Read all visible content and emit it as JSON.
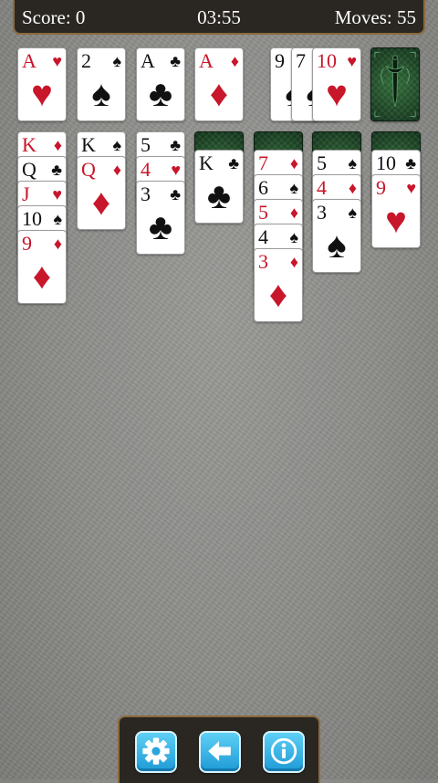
{
  "status_bar": {
    "score": "Score: 0",
    "timer": "03:55",
    "moves": "Moves: 55"
  },
  "colors": {
    "red_suit": "#c8162a",
    "black_suit": "#111111",
    "card_back": "#1f4a26",
    "button": "#1e9ad6",
    "bar_border": "#8a6a3c"
  },
  "foundations": [
    {
      "rank": "A",
      "suit": "♥",
      "color": "red"
    },
    {
      "rank": "2",
      "suit": "♠",
      "color": "black"
    },
    {
      "rank": "A",
      "suit": "♣",
      "color": "black"
    },
    {
      "rank": "A",
      "suit": "♦",
      "color": "red"
    }
  ],
  "waste": [
    {
      "rank": "9",
      "suit": "♠",
      "color": "black"
    },
    {
      "rank": "7",
      "suit": "♠",
      "color": "black"
    },
    {
      "rank": "10",
      "suit": "♥",
      "color": "red"
    }
  ],
  "stock": {
    "icon": "dagger-emblem-icon",
    "face_down": true
  },
  "tableau": [
    {
      "face_down": 0,
      "cards": [
        {
          "rank": "K",
          "suit": "♦",
          "color": "red"
        },
        {
          "rank": "Q",
          "suit": "♣",
          "color": "black"
        },
        {
          "rank": "J",
          "suit": "♥",
          "color": "red"
        },
        {
          "rank": "10",
          "suit": "♠",
          "color": "black"
        },
        {
          "rank": "9",
          "suit": "♦",
          "color": "red"
        }
      ]
    },
    {
      "face_down": 0,
      "cards": [
        {
          "rank": "K",
          "suit": "♠",
          "color": "black"
        },
        {
          "rank": "Q",
          "suit": "♦",
          "color": "red"
        }
      ]
    },
    {
      "face_down": 0,
      "cards": [
        {
          "rank": "5",
          "suit": "♣",
          "color": "black"
        },
        {
          "rank": "4",
          "suit": "♥",
          "color": "red"
        },
        {
          "rank": "3",
          "suit": "♣",
          "color": "black"
        }
      ]
    },
    {
      "face_down": 1,
      "cards": [
        {
          "rank": "K",
          "suit": "♣",
          "color": "black"
        }
      ]
    },
    {
      "face_down": 1,
      "cards": [
        {
          "rank": "7",
          "suit": "♦",
          "color": "red"
        },
        {
          "rank": "6",
          "suit": "♠",
          "color": "black"
        },
        {
          "rank": "5",
          "suit": "♦",
          "color": "red"
        },
        {
          "rank": "4",
          "suit": "♠",
          "color": "black"
        },
        {
          "rank": "3",
          "suit": "♦",
          "color": "red"
        }
      ]
    },
    {
      "face_down": 1,
      "cards": [
        {
          "rank": "5",
          "suit": "♠",
          "color": "black"
        },
        {
          "rank": "4",
          "suit": "♦",
          "color": "red"
        },
        {
          "rank": "3",
          "suit": "♠",
          "color": "black"
        }
      ]
    },
    {
      "face_down": 1,
      "cards": [
        {
          "rank": "10",
          "suit": "♣",
          "color": "black"
        },
        {
          "rank": "9",
          "suit": "♥",
          "color": "red"
        }
      ]
    }
  ],
  "toolbar": {
    "buttons": [
      {
        "name": "settings-button",
        "icon": "gear-icon"
      },
      {
        "name": "undo-button",
        "icon": "arrow-left-icon"
      },
      {
        "name": "info-button",
        "icon": "info-icon"
      }
    ]
  }
}
